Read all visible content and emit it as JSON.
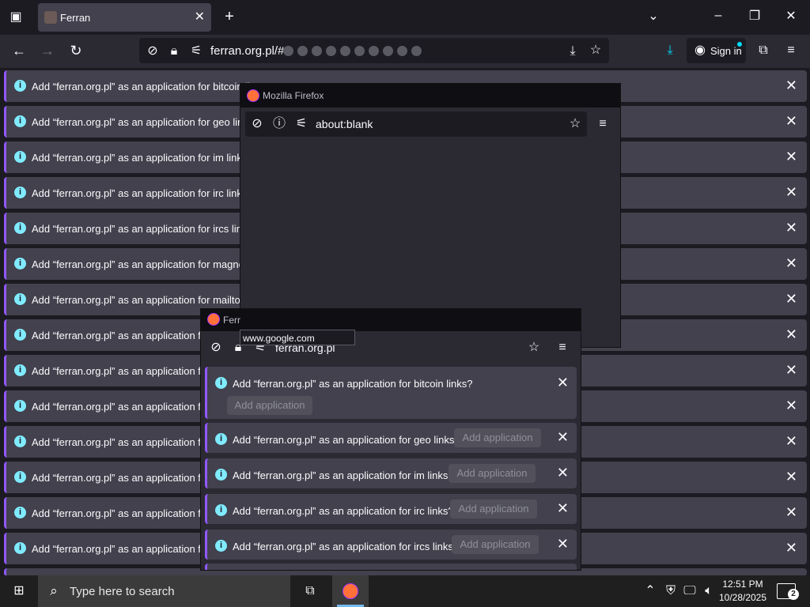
{
  "browser": {
    "tab_title": "Ferran",
    "url": "ferran.org.pl/#",
    "signin_label": "Sign in"
  },
  "notifications": [
    {
      "message": "Add “ferran.org.pl” as an application for bitcoin lin"
    },
    {
      "message": "Add “ferran.org.pl” as an application for geo links?"
    },
    {
      "message": "Add “ferran.org.pl” as an application for im links?"
    },
    {
      "message": "Add “ferran.org.pl” as an application for irc links?"
    },
    {
      "message": "Add “ferran.org.pl” as an application for ircs links?"
    },
    {
      "message": "Add “ferran.org.pl” as an application for magnet lin"
    },
    {
      "message": "Add “ferran.org.pl” as an application for mailto link"
    },
    {
      "message": "Add “ferran.org.pl” as an application for n"
    },
    {
      "message": "Add “ferran.org.pl” as an application for n"
    },
    {
      "message": "Add “ferran.org.pl” as an application for n"
    },
    {
      "message": "Add “ferran.org.pl” as an application for s"
    },
    {
      "message": "Add “ferran.org.pl” as an application for s"
    },
    {
      "message": "Add “ferran.org.pl” as an application for s"
    },
    {
      "message": "Add “ferran.org.pl” as an application for s"
    }
  ],
  "popup_top": {
    "window_title": "Mozilla Firefox",
    "url": "about:blank"
  },
  "popup_bottom": {
    "window_title": "Ferr",
    "url": "ferran.org.pl",
    "tooltip": "www.google.com",
    "notifications": [
      {
        "message": "Add “ferran.org.pl” as an application for bitcoin links?",
        "button": "Add application"
      },
      {
        "message": "Add “ferran.org.pl” as an application for geo links?",
        "button": "Add application"
      },
      {
        "message": "Add “ferran.org.pl” as an application for im links?",
        "button": "Add application"
      },
      {
        "message": "Add “ferran.org.pl” as an application for irc links?",
        "button": "Add application"
      },
      {
        "message": "Add “ferran.org.pl” as an application for ircs links?",
        "button": "Add application"
      }
    ]
  },
  "taskbar": {
    "search_placeholder": "Type here to search",
    "time": "12:51 PM",
    "date": "10/28/2025",
    "notification_count": "2"
  },
  "colors": {
    "accent": "#9059ff",
    "info": "#80ebff",
    "download": "#00ddff"
  }
}
